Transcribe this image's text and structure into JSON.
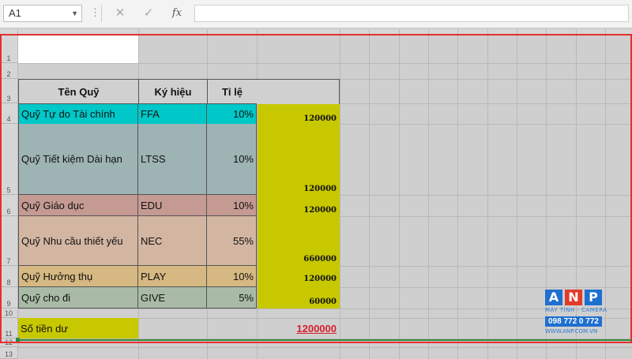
{
  "formula_bar": {
    "name_box": "A1",
    "fx_label": "fx",
    "formula": ""
  },
  "rows": [
    "1",
    "2",
    "3",
    "4",
    "5",
    "6",
    "7",
    "8",
    "9",
    "10",
    "11",
    "12",
    "13"
  ],
  "table": {
    "headers": [
      "Tên Quỹ",
      "Ký hiệu",
      "Tỉ lệ"
    ],
    "funds": [
      {
        "name": "Quỹ Tự do Tài chính",
        "code": "FFA",
        "ratio": "10%",
        "amount": "120000",
        "color": "#00c8c8"
      },
      {
        "name": "Quỹ Tiết kiệm Dài hạn",
        "code": "LTSS",
        "ratio": "10%",
        "amount": "120000",
        "color": "#9eb3b3"
      },
      {
        "name": "Quỹ Giáo dục",
        "code": "EDU",
        "ratio": "10%",
        "amount": "120000",
        "color": "#c49a92"
      },
      {
        "name": "Quỹ Nhu cầu thiết yếu",
        "code": "NEC",
        "ratio": "55%",
        "amount": "660000",
        "color": "#d3b6a2"
      },
      {
        "name": "Quỹ Hưởng thụ",
        "code": "PLAY",
        "ratio": "10%",
        "amount": "120000",
        "color": "#d6b882"
      },
      {
        "name": "Quỹ cho đi",
        "code": "GIVE",
        "ratio": "5%",
        "amount": "60000",
        "color": "#a9bba6"
      }
    ],
    "remaining_label": "Số tiền dư",
    "remaining_value": "1200000",
    "amount_column_color": "#c8c800"
  },
  "watermark": {
    "letters": [
      "A",
      "N",
      "P"
    ],
    "letter_colors": [
      "#1e6fd0",
      "#e23a2b",
      "#1e6fd0"
    ],
    "tagline": "MÁY TÍNH - CAMERA",
    "phone": "098 772 0 772",
    "website": "WWW.ANP.COM.VN"
  }
}
